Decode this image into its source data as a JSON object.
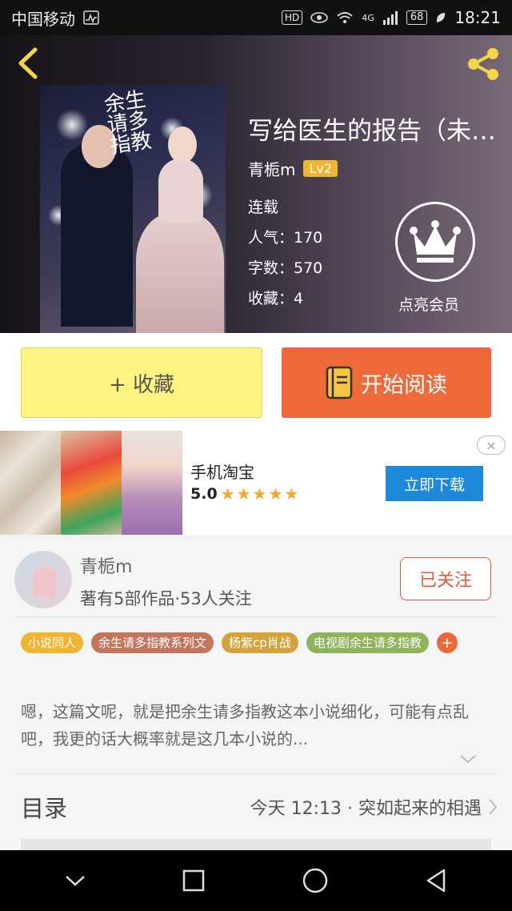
{
  "status_bar": {
    "carrier": "中国移动",
    "hd": "HD",
    "network": "4G",
    "battery": "68",
    "time": "18:21"
  },
  "book": {
    "cover_title": "余生请多指教",
    "title": "写给医生的报告（未完结）",
    "author": "青栀m",
    "level": "Lv2",
    "status": "连载",
    "popularity": "人气：170",
    "word_count": "字数：570",
    "favorites": "收藏：4",
    "vip_label": "点亮会员"
  },
  "actions": {
    "collect": "+ 收藏",
    "read": "开始阅读"
  },
  "ad": {
    "app_name": "手机淘宝",
    "rating": "5.0",
    "stars": "★★★★★",
    "download": "立即下载",
    "close": "×"
  },
  "author_card": {
    "name": "青栀m",
    "stats": "著有5部作品·53人关注",
    "follow": "已关注",
    "tags": [
      {
        "label": "小说同人",
        "color": "#f0b431"
      },
      {
        "label": "余生请多指教系列文",
        "color": "#c3745c"
      },
      {
        "label": "杨紫cp肖战",
        "color": "#d5a33d"
      },
      {
        "label": "电视剧余生请多指教",
        "color": "#8db45a"
      }
    ],
    "description": "嗯，这篇文呢，就是把余生请多指教这本小说细化，可能有点乱吧，我更的话大概率就是这几本小说的..."
  },
  "toc": {
    "title": "目录",
    "latest": "今天 12:13 · 突如起来的相遇"
  },
  "colors": {
    "accent": "#ee6a3a",
    "collect_bg": "#fff481",
    "vip": "#ffffff",
    "ad_button": "#1e88d9"
  },
  "icons": [
    "back-icon",
    "share-icon",
    "crown-icon",
    "book-icon",
    "chevron-right-icon",
    "chevron-down-icon",
    "nav-back-icon",
    "nav-home-icon",
    "nav-recent-icon",
    "nav-down-icon"
  ]
}
